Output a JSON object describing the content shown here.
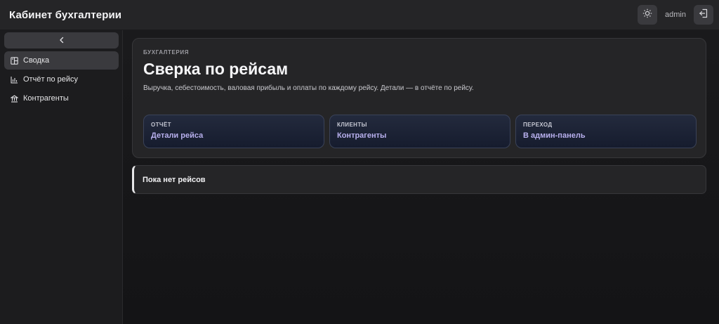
{
  "header": {
    "title": "Кабинет бухгалтерии",
    "user": "admin",
    "theme_icon": "sun-icon",
    "logout_icon": "logout-icon"
  },
  "sidebar": {
    "collapse_icon": "chevron-left-icon",
    "items": [
      {
        "label": "Сводка",
        "icon": "summary-icon",
        "active": true
      },
      {
        "label": "Отчёт по рейсу",
        "icon": "bar-chart-icon",
        "active": false
      },
      {
        "label": "Контрагенты",
        "icon": "bank-icon",
        "active": false
      }
    ]
  },
  "hero": {
    "eyebrow": "БУХГАЛТЕРИЯ",
    "title": "Сверка по рейсам",
    "description": "Выручка, себестоимость, валовая прибыль и оплаты по каждому рейсу. Детали — в отчёте по рейсу.",
    "cards": [
      {
        "kicker": "ОТЧЁТ",
        "title": "Детали рейса"
      },
      {
        "kicker": "КЛИЕНТЫ",
        "title": "Контрагенты"
      },
      {
        "kicker": "ПЕРЕХОД",
        "title": "В админ-панель"
      }
    ]
  },
  "empty_state": {
    "text": "Пока нет рейсов"
  },
  "colors": {
    "accent_text": "#b8b0ee",
    "card_bg": "#1b2236",
    "surface": "#252527"
  }
}
